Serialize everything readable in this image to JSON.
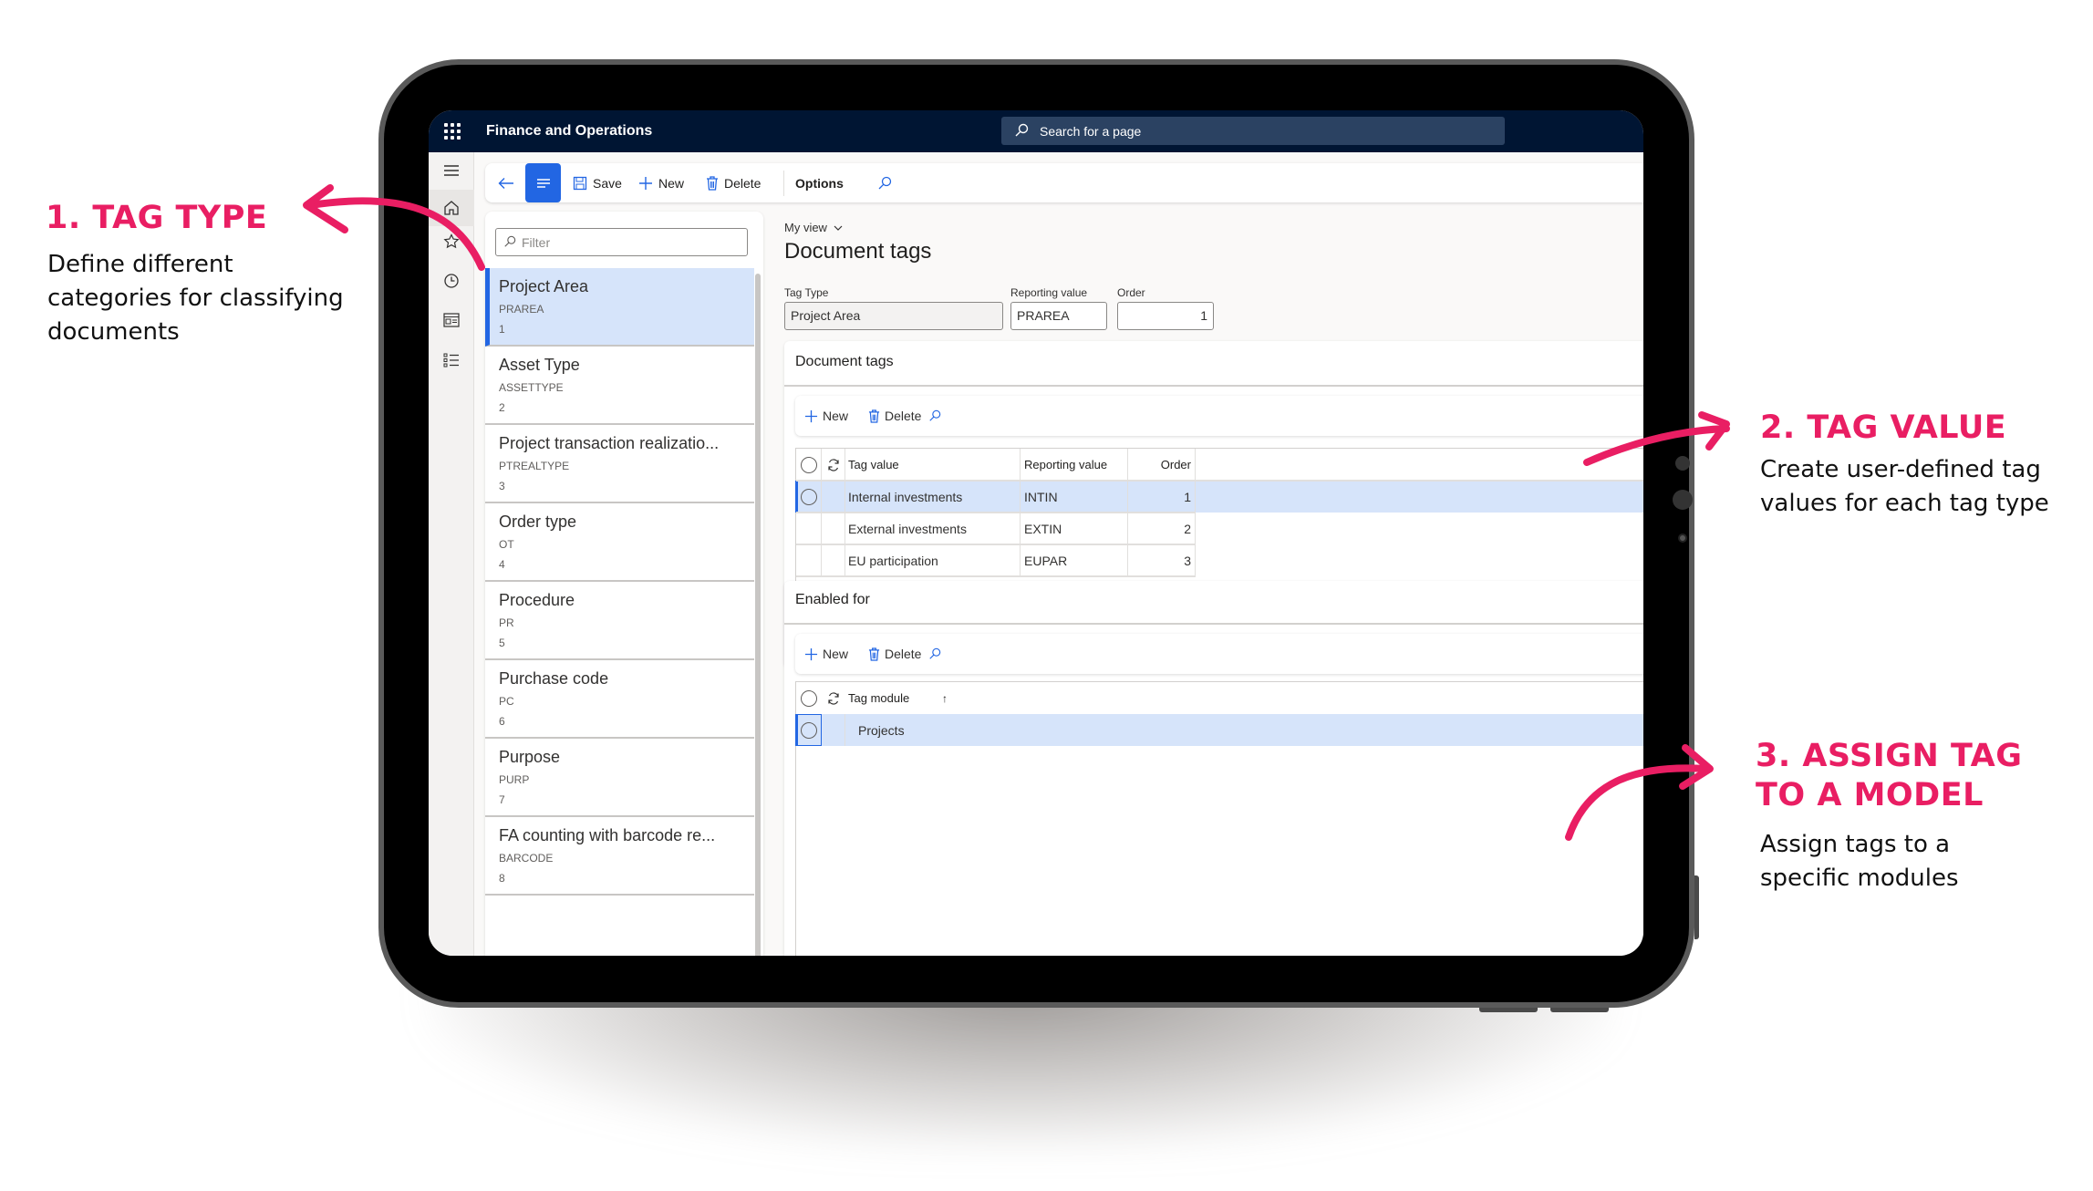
{
  "annotations": [
    {
      "title": "1. TAG TYPE",
      "desc_lines": [
        "Define different",
        "categories for classifying",
        "documents"
      ]
    },
    {
      "title": "2. TAG VALUE",
      "desc_lines": [
        "Create user-defined tag",
        "values for each tag type"
      ]
    },
    {
      "title_lines": [
        "3. ASSIGN TAG",
        "TO A MODEL"
      ],
      "desc_lines": [
        "Assign tags to a",
        "specific modules"
      ]
    }
  ],
  "colors": {
    "accent_pink": "#e91e63",
    "header_navy": "#001533",
    "brand_blue": "#2266e3",
    "selection": "#d6e4fa"
  },
  "app": {
    "title": "Finance and Operations",
    "search_placeholder": "Search for a page"
  },
  "rail": {
    "icons": [
      "hamburger-icon",
      "home-icon",
      "star-icon",
      "clock-icon",
      "workspace-icon",
      "list-icon"
    ]
  },
  "actionbar": {
    "back_icon": "arrow-left-icon",
    "save": "Save",
    "new": "New",
    "delete": "Delete",
    "options": "Options"
  },
  "list": {
    "filter_placeholder": "Filter",
    "items": [
      {
        "name": "Project Area",
        "code": "PRAREA",
        "order": "1",
        "selected": true
      },
      {
        "name": "Asset Type",
        "code": "ASSETTYPE",
        "order": "2"
      },
      {
        "name": "Project transaction realizatio...",
        "code": "PTREALTYPE",
        "order": "3"
      },
      {
        "name": "Order type",
        "code": "OT",
        "order": "4"
      },
      {
        "name": "Procedure",
        "code": "PR",
        "order": "5"
      },
      {
        "name": "Purchase code",
        "code": "PC",
        "order": "6"
      },
      {
        "name": "Purpose",
        "code": "PURP",
        "order": "7"
      },
      {
        "name": "FA counting with barcode re...",
        "code": "BARCODE",
        "order": "8"
      }
    ]
  },
  "main": {
    "view": "My view",
    "title": "Document tags",
    "fields": {
      "tag_type_label": "Tag Type",
      "tag_type_value": "Project Area",
      "reporting_label": "Reporting value",
      "reporting_value": "PRAREA",
      "order_label": "Order",
      "order_value": "1"
    },
    "tags_section": {
      "title": "Document tags",
      "new": "New",
      "delete": "Delete",
      "columns": [
        "Tag value",
        "Reporting value",
        "Order"
      ],
      "rows": [
        {
          "tag_value": "Internal investments",
          "reporting": "INTIN",
          "order": "1",
          "selected": true
        },
        {
          "tag_value": "External investments",
          "reporting": "EXTIN",
          "order": "2"
        },
        {
          "tag_value": "EU participation",
          "reporting": "EUPAR",
          "order": "3"
        }
      ]
    },
    "enabled_section": {
      "title": "Enabled for",
      "new": "New",
      "delete": "Delete",
      "columns": [
        "Tag module"
      ],
      "sort_indicator": "↑",
      "rows": [
        {
          "module": "Projects",
          "selected": true
        }
      ]
    }
  }
}
